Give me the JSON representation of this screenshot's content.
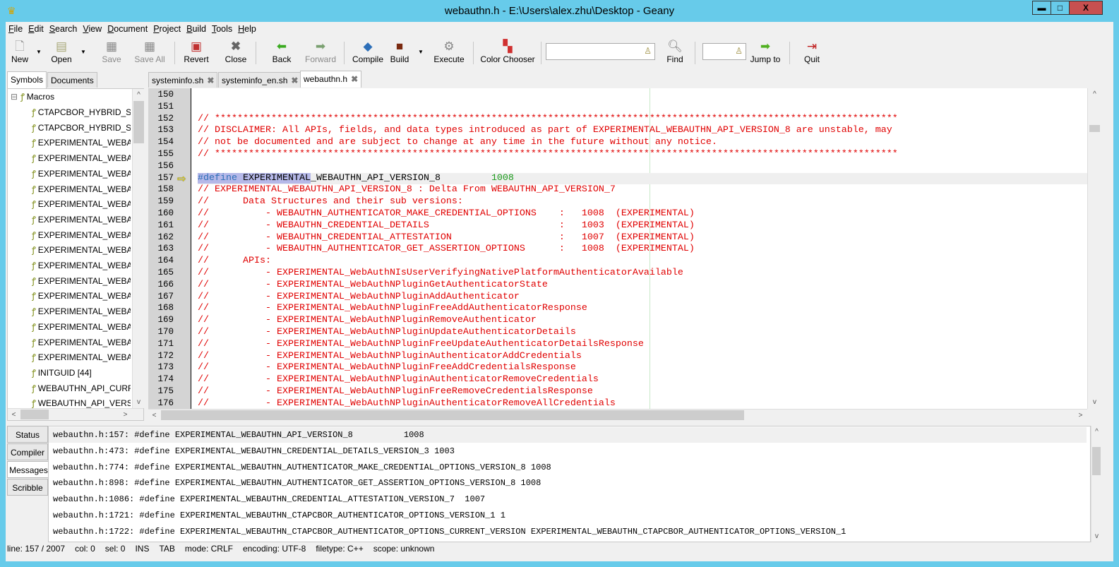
{
  "window": {
    "title": "webauthn.h - E:\\Users\\alex.zhu\\Desktop - Geany",
    "controls": [
      "minimize",
      "maximize",
      "close"
    ]
  },
  "menu": [
    "File",
    "Edit",
    "Search",
    "View",
    "Document",
    "Project",
    "Build",
    "Tools",
    "Help"
  ],
  "toolbar": {
    "new": "New",
    "open": "Open",
    "save": "Save",
    "save_all": "Save All",
    "revert": "Revert",
    "close": "Close",
    "back": "Back",
    "forward": "Forward",
    "compile": "Compile",
    "build": "Build",
    "execute": "Execute",
    "color_chooser": "Color Chooser",
    "search_value": "",
    "find": "Find",
    "goto_value": "",
    "jump_to": "Jump to",
    "quit": "Quit"
  },
  "sidebar": {
    "tabs": [
      "Symbols",
      "Documents"
    ],
    "group": "Macros",
    "items": [
      "CTAPCBOR_HYBRID_ST",
      "CTAPCBOR_HYBRID_ST",
      "EXPERIMENTAL_WEBA",
      "EXPERIMENTAL_WEBA",
      "EXPERIMENTAL_WEBA",
      "EXPERIMENTAL_WEBA",
      "EXPERIMENTAL_WEBA",
      "EXPERIMENTAL_WEBA",
      "EXPERIMENTAL_WEBA",
      "EXPERIMENTAL_WEBA",
      "EXPERIMENTAL_WEBA",
      "EXPERIMENTAL_WEBA",
      "EXPERIMENTAL_WEBA",
      "EXPERIMENTAL_WEBA",
      "EXPERIMENTAL_WEBA",
      "EXPERIMENTAL_WEBA",
      "EXPERIMENTAL_WEBA",
      "INITGUID [44]",
      "WEBAUTHN_API_CURR",
      "WEBAUTHN_API_VERS"
    ]
  },
  "editor": {
    "tabs": [
      {
        "label": "systeminfo.sh"
      },
      {
        "label": "systeminfo_en.sh"
      },
      {
        "label": "webauthn.h",
        "active": true
      }
    ],
    "current_line": 157,
    "lines": [
      {
        "n": 150,
        "text": ""
      },
      {
        "n": 151,
        "text": ""
      },
      {
        "n": 152,
        "text": "// *************************************************************************************************************************"
      },
      {
        "n": 153,
        "text": "// DISCLAIMER: All APIs, fields, and data types introduced as part of EXPERIMENTAL_WEBAUTHN_API_VERSION_8 are unstable, may"
      },
      {
        "n": 154,
        "text": "// not be documented and are subject to change at any time in the future without any notice."
      },
      {
        "n": 155,
        "text": "// *************************************************************************************************************************"
      },
      {
        "n": 156,
        "text": ""
      },
      {
        "n": 157,
        "segments": [
          {
            "t": "#",
            "c": "kw sel"
          },
          {
            "t": "define",
            "c": "kw sel"
          },
          {
            "t": " EXPERIMENTAL",
            "c": "idn sel"
          },
          {
            "t": "_WEBAUTHN_API_VERSION_8         ",
            "c": "idn"
          },
          {
            "t": "1008",
            "c": "num"
          }
        ]
      },
      {
        "n": 158,
        "text": "// EXPERIMENTAL_WEBAUTHN_API_VERSION_8 : Delta From WEBAUTHN_API_VERSION_7"
      },
      {
        "n": 159,
        "text": "//      Data Structures and their sub versions:"
      },
      {
        "n": 160,
        "text": "//          - WEBAUTHN_AUTHENTICATOR_MAKE_CREDENTIAL_OPTIONS    :   1008  (EXPERIMENTAL)"
      },
      {
        "n": 161,
        "text": "//          - WEBAUTHN_CREDENTIAL_DETAILS                       :   1003  (EXPERIMENTAL)"
      },
      {
        "n": 162,
        "text": "//          - WEBAUTHN_CREDENTIAL_ATTESTATION                   :   1007  (EXPERIMENTAL)"
      },
      {
        "n": 163,
        "text": "//          - WEBAUTHN_AUTHENTICATOR_GET_ASSERTION_OPTIONS      :   1008  (EXPERIMENTAL)"
      },
      {
        "n": 164,
        "text": "//      APIs:"
      },
      {
        "n": 165,
        "text": "//          - EXPERIMENTAL_WebAuthNIsUserVerifyingNativePlatformAuthenticatorAvailable"
      },
      {
        "n": 166,
        "text": "//          - EXPERIMENTAL_WebAuthNPluginGetAuthenticatorState"
      },
      {
        "n": 167,
        "text": "//          - EXPERIMENTAL_WebAuthNPluginAddAuthenticator"
      },
      {
        "n": 168,
        "text": "//          - EXPERIMENTAL_WebAuthNPluginFreeAddAuthenticatorResponse"
      },
      {
        "n": 169,
        "text": "//          - EXPERIMENTAL_WebAuthNPluginRemoveAuthenticator"
      },
      {
        "n": 170,
        "text": "//          - EXPERIMENTAL_WebAuthNPluginUpdateAuthenticatorDetails"
      },
      {
        "n": 171,
        "text": "//          - EXPERIMENTAL_WebAuthNPluginFreeUpdateAuthenticatorDetailsResponse"
      },
      {
        "n": 172,
        "text": "//          - EXPERIMENTAL_WebAuthNPluginAuthenticatorAddCredentials"
      },
      {
        "n": 173,
        "text": "//          - EXPERIMENTAL_WebAuthNPluginFreeAddCredentialsResponse"
      },
      {
        "n": 174,
        "text": "//          - EXPERIMENTAL_WebAuthNPluginAuthenticatorRemoveCredentials"
      },
      {
        "n": 175,
        "text": "//          - EXPERIMENTAL_WebAuthNPluginFreeRemoveCredentialsResponse"
      },
      {
        "n": 176,
        "text": "//          - EXPERIMENTAL_WebAuthNPluginAuthenticatorRemoveAllCredentials"
      }
    ]
  },
  "bottom": {
    "tabs": [
      "Status",
      "Compiler",
      "Messages",
      "Scribble"
    ],
    "active_tab": "Messages",
    "messages": [
      "webauthn.h:157: #define EXPERIMENTAL_WEBAUTHN_API_VERSION_8          1008",
      "webauthn.h:473: #define EXPERIMENTAL_WEBAUTHN_CREDENTIAL_DETAILS_VERSION_3 1003",
      "webauthn.h:774: #define EXPERIMENTAL_WEBAUTHN_AUTHENTICATOR_MAKE_CREDENTIAL_OPTIONS_VERSION_8 1008",
      "webauthn.h:898: #define EXPERIMENTAL_WEBAUTHN_AUTHENTICATOR_GET_ASSERTION_OPTIONS_VERSION_8 1008",
      "webauthn.h:1086: #define EXPERIMENTAL_WEBAUTHN_CREDENTIAL_ATTESTATION_VERSION_7  1007",
      "webauthn.h:1721: #define EXPERIMENTAL_WEBAUTHN_CTAPCBOR_AUTHENTICATOR_OPTIONS_VERSION_1 1",
      "webauthn.h:1722: #define EXPERIMENTAL_WEBAUTHN_CTAPCBOR_AUTHENTICATOR_OPTIONS_CURRENT_VERSION EXPERIMENTAL_WEBAUTHN_CTAPCBOR_AUTHENTICATOR_OPTIONS_VERSION_1"
    ]
  },
  "statusbar": {
    "line": "line: 157 / 2007",
    "col": "col: 0",
    "sel": "sel: 0",
    "ins": "INS",
    "tab": "TAB",
    "mode": "mode: CRLF",
    "encoding": "encoding: UTF-8",
    "filetype": "filetype: C++",
    "scope": "scope: unknown"
  },
  "colors": {
    "titlebar": "#67cbea",
    "comment": "#e00000",
    "keyword": "#2d6fb8",
    "number": "#1b9a1b",
    "selection": "#b5b8e8",
    "close_button": "#c75050"
  }
}
